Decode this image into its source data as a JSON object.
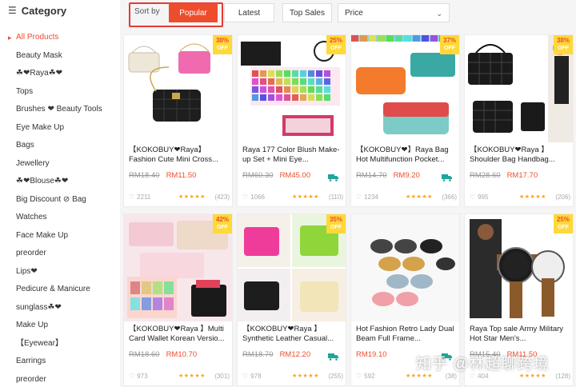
{
  "sidebar": {
    "title": "Category",
    "items": [
      {
        "label": "All Products",
        "active": true
      },
      {
        "label": "Beauty Mask"
      },
      {
        "label": "☘❤Raya☘❤"
      },
      {
        "label": "Tops"
      },
      {
        "label": "Brushes ❤ Beauty Tools"
      },
      {
        "label": "Eye Make Up"
      },
      {
        "label": "Bags"
      },
      {
        "label": "Jewellery"
      },
      {
        "label": "☘❤Blouse☘❤"
      },
      {
        "label": "Big Discount ⊘ Bag"
      },
      {
        "label": "Watches"
      },
      {
        "label": "Face Make Up"
      },
      {
        "label": "preorder"
      },
      {
        "label": "Lips❤"
      },
      {
        "label": "Pedicure & Manicure"
      },
      {
        "label": "sunglass☘❤"
      },
      {
        "label": "Make Up"
      },
      {
        "label": "【Eyewear】"
      },
      {
        "label": "Earrings"
      },
      {
        "label": "preorder"
      }
    ]
  },
  "sortbar": {
    "sort_by_label": "Sort by",
    "popular": "Popular",
    "latest": "Latest",
    "top_sales": "Top Sales",
    "price": "Price"
  },
  "products": [
    {
      "title": "【KOKOBUY❤Raya】Fashion Cute Mini Cross...",
      "old_price": "RM18.40",
      "price": "RM11.50",
      "badge_pct": "38%",
      "badge_off": "OFF",
      "likes": "2211",
      "reviews": "(423)",
      "ship": false
    },
    {
      "title": "Raya 177 Color Blush Make-up Set + Mini Eye...",
      "old_price": "RM60.30",
      "price": "RM45.00",
      "badge_pct": "25%",
      "badge_off": "OFF",
      "likes": "1066",
      "reviews": "(110)",
      "ship": true
    },
    {
      "title": "【KOKOBUY❤】Raya Bag Hot Multifunction Pocket...",
      "old_price": "RM14.70",
      "price": "RM9.20",
      "badge_pct": "37%",
      "badge_off": "OFF",
      "likes": "1234",
      "reviews": "(366)",
      "ship": true
    },
    {
      "title": "【KOKOBUY❤Raya 】Shoulder Bag Handbag...",
      "old_price": "RM28.60",
      "price": "RM17.70",
      "badge_pct": "38%",
      "badge_off": "OFF",
      "likes": "995",
      "reviews": "(206)",
      "ship": false
    },
    {
      "title": "【KOKOBUY❤Raya 】Multi Card Wallet Korean Versio...",
      "old_price": "RM18.60",
      "price": "RM10.70",
      "badge_pct": "42%",
      "badge_off": "OFF",
      "likes": "973",
      "reviews": "(301)",
      "ship": false
    },
    {
      "title": "【KOKOBUY❤Raya 】Synthetic Leather Casual...",
      "old_price": "RM18.70",
      "price": "RM12.20",
      "badge_pct": "35%",
      "badge_off": "OFF",
      "likes": "978",
      "reviews": "(255)",
      "ship": true
    },
    {
      "title": "Hot Fashion Retro Lady Dual Beam Full Frame...",
      "old_price": "",
      "price": "RM19.10",
      "badge_pct": "",
      "badge_off": "",
      "likes": "592",
      "reviews": "(38)",
      "ship": true
    },
    {
      "title": "Raya Top sale Army Military Hot Star Men's...",
      "old_price": "RM15.40",
      "price": "RM11.50",
      "badge_pct": "25%",
      "badge_off": "OFF",
      "likes": "404",
      "reviews": "(128)",
      "ship": false
    }
  ],
  "rating_stars": "★★★★★",
  "watermark": "知乎 @林超聊跨境",
  "colors": {
    "accent": "#ee4d2d",
    "badge": "#ffd839",
    "highlight_box": "#e53935",
    "ship_icon": "#1fa59a"
  }
}
